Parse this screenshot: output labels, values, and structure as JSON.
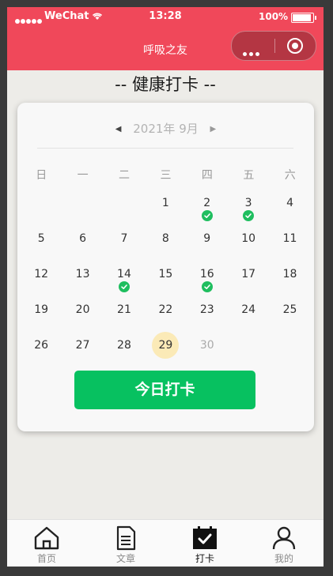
{
  "status_bar": {
    "carrier": "WeChat",
    "time": "13:28",
    "battery": "100%"
  },
  "nav": {
    "title": "呼吸之友"
  },
  "page": {
    "title": "-- 健康打卡 --"
  },
  "calendar": {
    "month_label": "2021年 9月",
    "weekdays": [
      "日",
      "一",
      "二",
      "三",
      "四",
      "五",
      "六"
    ],
    "leading_blanks": 3,
    "days": [
      {
        "d": "1"
      },
      {
        "d": "2",
        "checked": true
      },
      {
        "d": "3",
        "checked": true
      },
      {
        "d": "4"
      },
      {
        "d": "5"
      },
      {
        "d": "6"
      },
      {
        "d": "7"
      },
      {
        "d": "8"
      },
      {
        "d": "9"
      },
      {
        "d": "10"
      },
      {
        "d": "11"
      },
      {
        "d": "12"
      },
      {
        "d": "13"
      },
      {
        "d": "14",
        "checked": true
      },
      {
        "d": "15"
      },
      {
        "d": "16",
        "checked": true
      },
      {
        "d": "17"
      },
      {
        "d": "18"
      },
      {
        "d": "19"
      },
      {
        "d": "20"
      },
      {
        "d": "21"
      },
      {
        "d": "22"
      },
      {
        "d": "23"
      },
      {
        "d": "24"
      },
      {
        "d": "25"
      },
      {
        "d": "26"
      },
      {
        "d": "27"
      },
      {
        "d": "28"
      },
      {
        "d": "29",
        "today": true
      },
      {
        "d": "30",
        "future": true
      }
    ]
  },
  "punch_button": {
    "label": "今日打卡"
  },
  "tabbar": {
    "items": [
      {
        "label": "首页",
        "icon": "home-icon"
      },
      {
        "label": "文章",
        "icon": "document-icon"
      },
      {
        "label": "打卡",
        "icon": "calendar-check-icon",
        "active": true
      },
      {
        "label": "我的",
        "icon": "user-icon"
      }
    ]
  },
  "colors": {
    "header": "#f0485a",
    "accent_green": "#07c160",
    "today_highlight": "#fbeab7"
  }
}
